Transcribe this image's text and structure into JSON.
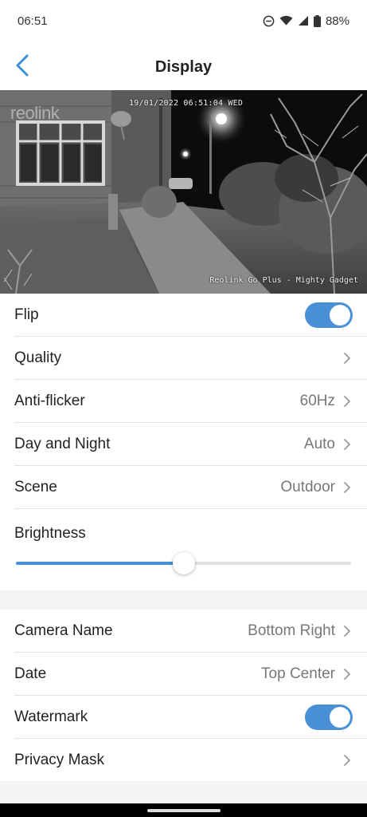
{
  "status": {
    "time": "06:51",
    "battery": "88%"
  },
  "header": {
    "title": "Display"
  },
  "preview": {
    "date_overlay": "19/01/2022 06:51:04 WED",
    "name_overlay": "Reolink Go Plus - Mighty Gadget",
    "logo": "reolink"
  },
  "settings": {
    "flip": {
      "label": "Flip",
      "on": true
    },
    "quality": {
      "label": "Quality"
    },
    "anti_flicker": {
      "label": "Anti-flicker",
      "value": "60Hz"
    },
    "day_night": {
      "label": "Day and Night",
      "value": "Auto"
    },
    "scene": {
      "label": "Scene",
      "value": "Outdoor"
    },
    "brightness": {
      "label": "Brightness",
      "level": 0.5
    }
  },
  "osd": {
    "camera_name": {
      "label": "Camera Name",
      "value": "Bottom Right"
    },
    "date": {
      "label": "Date",
      "value": "Top Center"
    },
    "watermark": {
      "label": "Watermark",
      "on": true
    },
    "privacy_mask": {
      "label": "Privacy Mask"
    }
  },
  "colors": {
    "accent": "#4a90d9",
    "chevron": "#9a9a9a",
    "back": "#3a8fd6"
  },
  "icons": {
    "back": "back-arrow-icon",
    "chevron": "chevron-right-icon",
    "dnd": "do-not-disturb-icon",
    "wifi": "wifi-icon",
    "signal": "cell-signal-icon",
    "battery": "battery-icon"
  }
}
